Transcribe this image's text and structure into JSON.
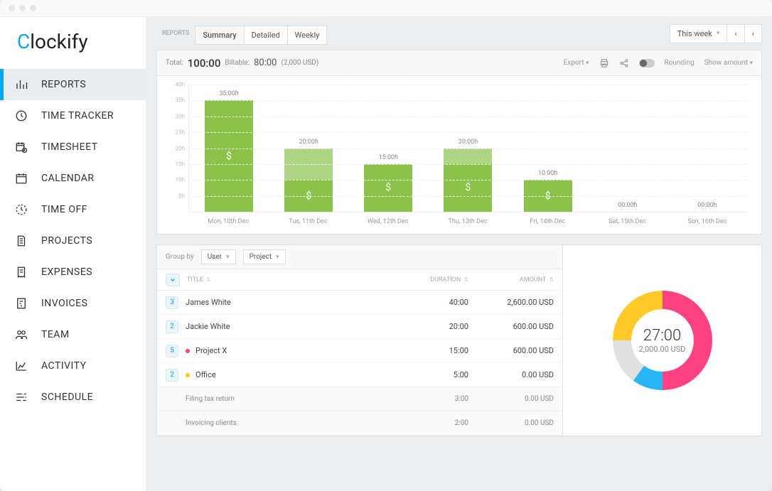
{
  "brand": "lockify",
  "sidebar": {
    "items": [
      {
        "label": "REPORTS",
        "icon": "bar-chart"
      },
      {
        "label": "TIME TRACKER",
        "icon": "clock"
      },
      {
        "label": "TIMESHEET",
        "icon": "calendar-clock"
      },
      {
        "label": "CALENDAR",
        "icon": "calendar"
      },
      {
        "label": "TIME OFF",
        "icon": "clock-dash"
      },
      {
        "label": "PROJECTS",
        "icon": "file"
      },
      {
        "label": "EXPENSES",
        "icon": "receipt"
      },
      {
        "label": "INVOICES",
        "icon": "invoice"
      },
      {
        "label": "TEAM",
        "icon": "users"
      },
      {
        "label": "ACTIVITY",
        "icon": "activity"
      },
      {
        "label": "SCHEDULE",
        "icon": "schedule"
      }
    ]
  },
  "topbar": {
    "reports_label": "REPORTS",
    "tabs": [
      "Summary",
      "Detailed",
      "Weekly"
    ],
    "range": "This week"
  },
  "chart_head": {
    "total_label": "Total:",
    "total": "100:00",
    "billable_label": "Billable:",
    "billable": "80:00",
    "billable_amount": "(2,000 USD)",
    "export": "Export",
    "rounding": "Rounding",
    "show_amount": "Show amount"
  },
  "chart_data": {
    "type": "bar",
    "ylabel_suffix": "h",
    "ylim": [
      0,
      40
    ],
    "yticks": [
      5,
      10,
      15,
      20,
      25,
      30,
      35,
      40
    ],
    "categories": [
      "Mon, 10th Dec",
      "Tue, 11th Dec",
      "Wed, 12th Dec",
      "Thu, 13th Dec",
      "Fri, 14th Dec",
      "Sat, 15th Dec",
      "Sun, 16th Dec"
    ],
    "series": [
      {
        "name": "billable",
        "values": [
          35,
          10,
          15,
          15,
          10,
          0,
          0
        ]
      },
      {
        "name": "non_billable",
        "values": [
          0,
          10,
          0,
          5,
          0,
          0,
          0
        ]
      }
    ],
    "totals_label": [
      "35:00h",
      "20:00h",
      "15:00h",
      "20:00h",
      "10:00h",
      "00:00h",
      "00:00h"
    ]
  },
  "table": {
    "group_by_label": "Group by",
    "group1": "User",
    "group2": "Project",
    "cols": {
      "title": "TITLE",
      "duration": "DURATION",
      "amount": "AMOUNT"
    },
    "rows": [
      {
        "type": "group",
        "badge": "3",
        "title": "James White",
        "duration": "40:00",
        "amount": "2,600.00 USD"
      },
      {
        "type": "group",
        "badge": "2",
        "title": "Jackie White",
        "duration": "20:00",
        "amount": "600.00 USD"
      },
      {
        "type": "project",
        "badge": "5",
        "dot": "#ff4081",
        "title": "Project X",
        "duration": "15:00",
        "amount": "600.00 USD"
      },
      {
        "type": "project",
        "badge": "2",
        "dot": "#ffca28",
        "title": "Office",
        "duration": "5:00",
        "amount": "0.00 USD"
      },
      {
        "type": "task",
        "title": "Filing tax return",
        "duration": "3:00",
        "amount": "0.00 USD"
      },
      {
        "type": "task",
        "title": "Invoicing clients",
        "duration": "2:00",
        "amount": "0.00 USD"
      }
    ]
  },
  "donut": {
    "center_time": "27:00",
    "center_amount": "2,000.00 USD",
    "slices": [
      {
        "color": "#ff4081",
        "value": 50
      },
      {
        "color": "#29b6f6",
        "value": 10
      },
      {
        "color": "#e0e0e0",
        "value": 15
      },
      {
        "color": "#ffca28",
        "value": 25
      }
    ]
  }
}
